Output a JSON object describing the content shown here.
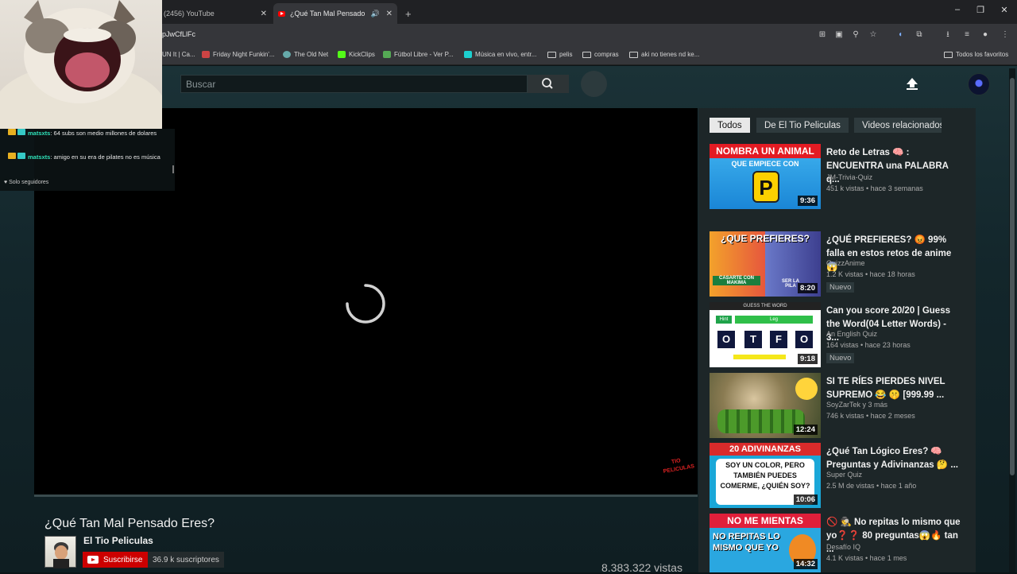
{
  "browser": {
    "tabs": [
      {
        "label": "(2456) YouTube",
        "active": false
      },
      {
        "label": "¿Qué Tan Mal Pensado Eres?",
        "active": true
      }
    ],
    "url": "pJwCfLlFc",
    "bookmarks": [
      "UN It | Ca...",
      "Friday Night Funkin'...",
      "The Old Net",
      "KickClips",
      "Fútbol Libre - Ver P...",
      "Música en vivo, entr...",
      "pelis",
      "compras",
      "aki no tienes nd ke..."
    ],
    "all_bookmarks_label": "Todos los favoritos"
  },
  "chat": {
    "messages": [
      {
        "user": "matsxts",
        "text": ": 64 subs son medio millones de dolares"
      },
      {
        "user": "matsxts",
        "text": ": amigo en su era de pilates no es música"
      }
    ],
    "mode": "Solo seguidores"
  },
  "header": {
    "search_placeholder": "Buscar"
  },
  "video": {
    "title": "¿Qué Tan Mal Pensado Eres?",
    "channel": "El Tio Peliculas",
    "subscribe_label": "Suscribirse",
    "subscribers": "36.9 k suscriptores",
    "views": "8.383.322 vistas",
    "watermark": "TIO PELICULAS"
  },
  "sidebar": {
    "chips": [
      "Todos",
      "De El Tio Peliculas",
      "Videos relacionados"
    ],
    "items": [
      {
        "title": "Reto de Letras 🧠 : ENCUENTRA una PALABRA q...",
        "channel": "JM-Trivia-Quiz",
        "meta": "451 k vistas • hace 3 semanas",
        "duration": "9:36",
        "new": "",
        "thumb_text": [
          "NOMBRA UN ANIMAL",
          "QUE EMPIECE CON",
          "P"
        ]
      },
      {
        "title": "¿QUÉ PREFIERES? 😡 99% falla en estos retos de anime 😱",
        "channel": "QuizzAnime",
        "meta": "1.2 K vistas • hace 18 horas",
        "duration": "8:20",
        "new": "Nuevo",
        "thumb_text": [
          "¿QUE PREFIERES?",
          "CASARTE CON MAKIMA",
          "SER LA PILA"
        ]
      },
      {
        "title": "Can you score 20/20 | Guess the Word(04 Letter Words) - 3...",
        "channel": "An English Quiz",
        "meta": "164 vistas • hace 23 horas",
        "duration": "9:18",
        "new": "Nuevo",
        "thumb_text": [
          "GUESS THE WORD",
          "Hint",
          "Leg",
          "O",
          "T",
          "F",
          "O"
        ]
      },
      {
        "title": "SI TE RÍES PIERDES NIVEL SUPREMO 😂 🤫 [999.99 ...",
        "channel": "SoyZarTek y 3 más",
        "meta": "746 k vistas • hace 2 meses",
        "duration": "12:24",
        "new": "",
        "thumb_text": []
      },
      {
        "title": "¿Qué Tan Lógico Eres? 🧠 Preguntas y Adivinanzas 🤔 ...",
        "channel": "Super Quiz",
        "meta": "2.5 M de vistas • hace 1 año",
        "duration": "10:06",
        "new": "",
        "thumb_text": [
          "20 ADIVINANZAS",
          "SOY UN COLOR, PERO TAMBIÉN PUEDES COMERME, ¿QUIÉN SOY?"
        ]
      },
      {
        "title": "🚫 🕵 No repitas lo mismo que yo❓❓ 80 preguntas😱🔥 tan ...",
        "channel": "Desafío IQ",
        "meta": "4.1 K vistas • hace 1 mes",
        "duration": "14:32",
        "new": "",
        "thumb_text": [
          "NO ME MIENTAS",
          "NO REPITAS LO MISMO QUE YO"
        ]
      }
    ]
  }
}
